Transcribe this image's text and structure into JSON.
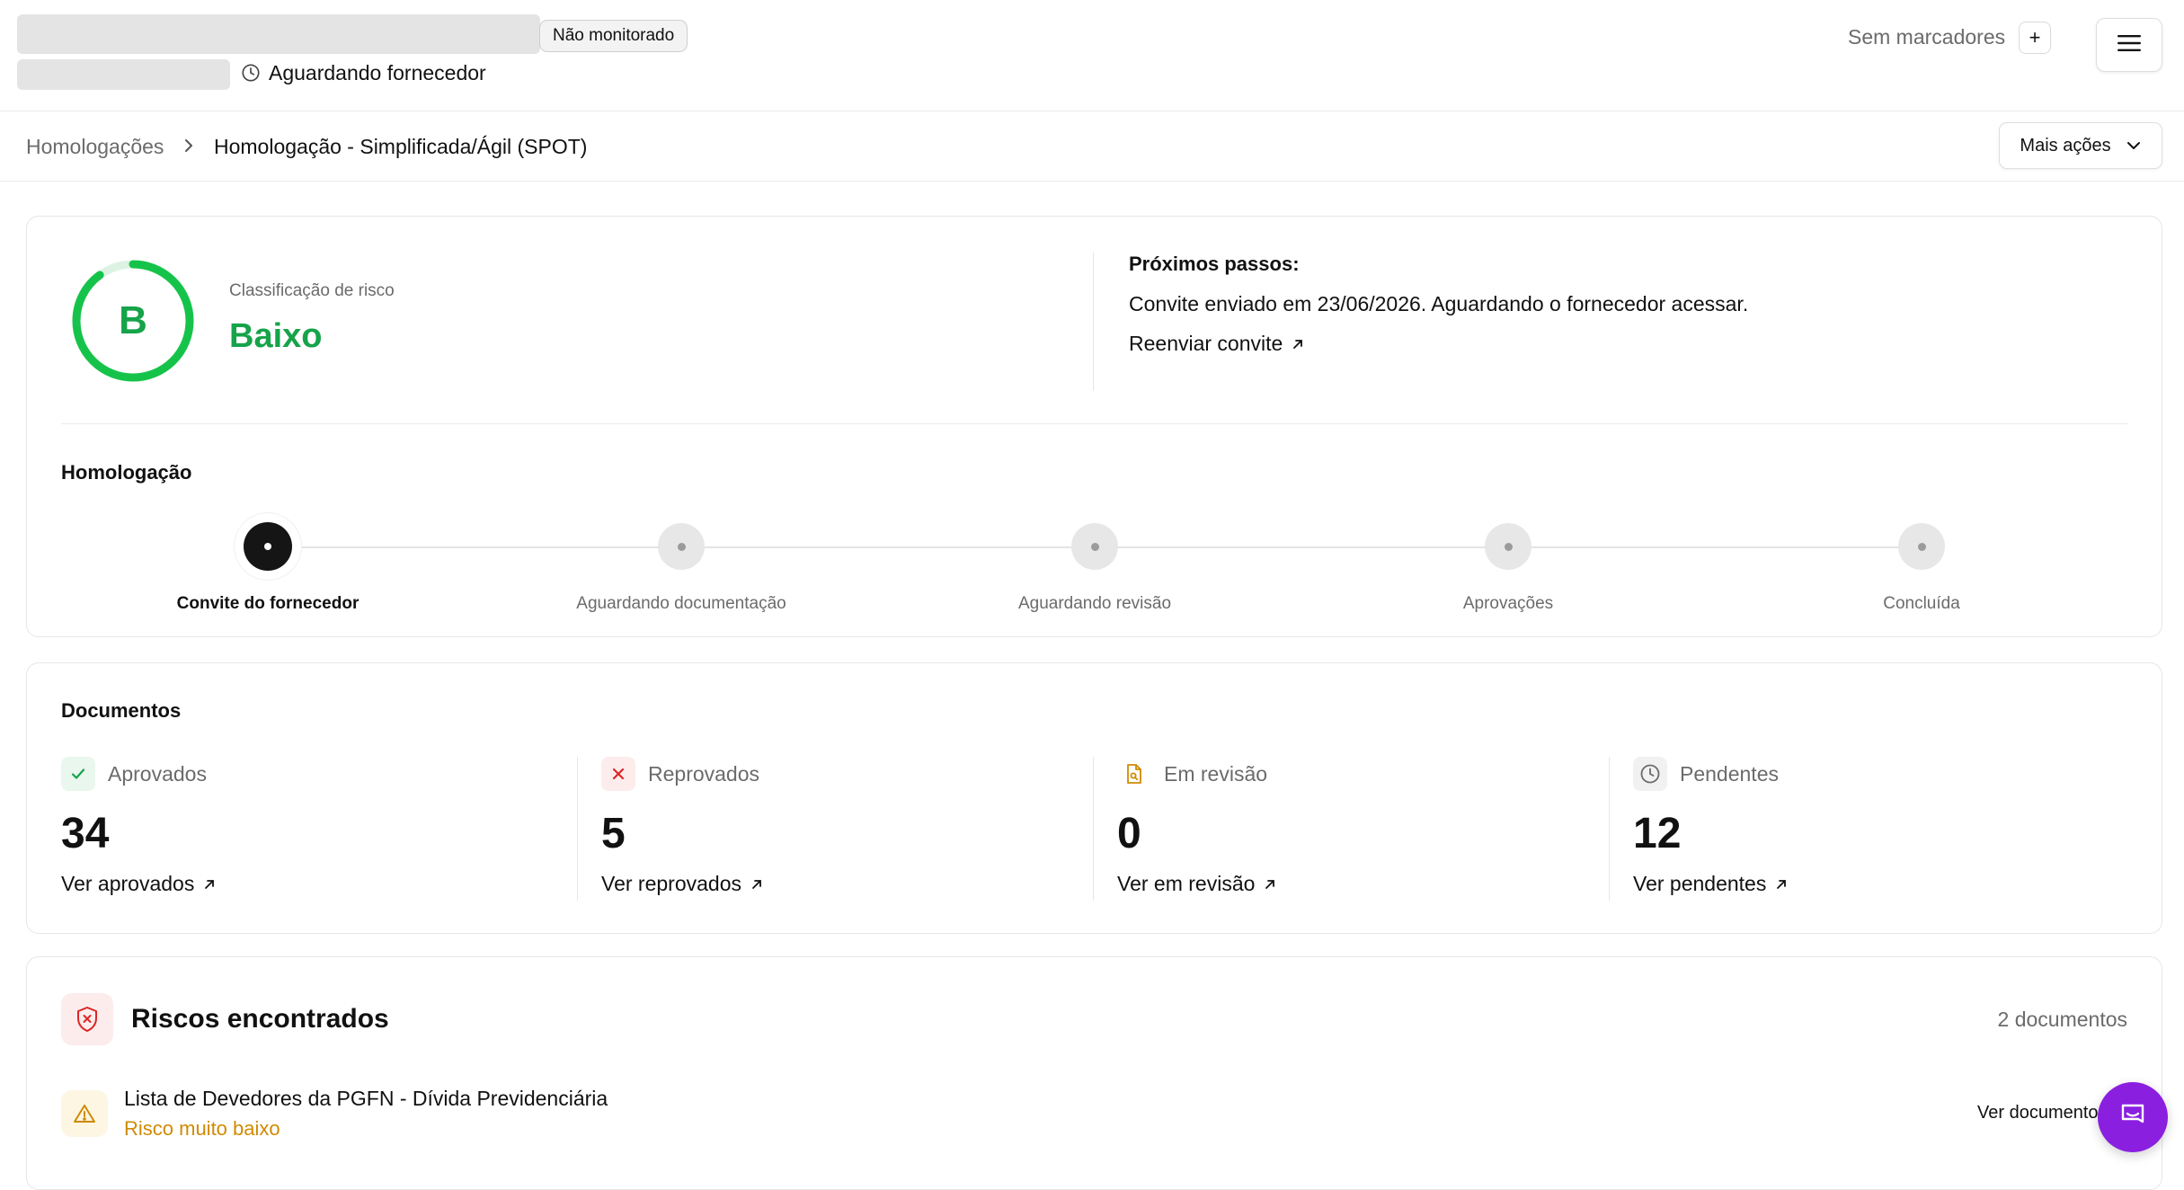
{
  "header": {
    "monitor_badge": "Não monitorado",
    "status": "Aguardando fornecedor",
    "tags_label": "Sem marcadores",
    "tags_add": "+"
  },
  "breadcrumb": {
    "root": "Homologações",
    "current": "Homologação - Simplificada/Ágil (SPOT)",
    "actions_label": "Mais ações"
  },
  "risk": {
    "grade": "B",
    "caption": "Classificação de risco",
    "level": "Baixo",
    "grade_progress": 0.9,
    "color": "#16a34a"
  },
  "next_steps": {
    "title": "Próximos passos:",
    "text": "Convite enviado em 23/06/2026. Aguardando o fornecedor acessar.",
    "link": "Reenviar convite"
  },
  "homologation": {
    "title": "Homologação",
    "current_step": 0,
    "steps": [
      {
        "label": "Convite do fornecedor"
      },
      {
        "label": "Aguardando documentação"
      },
      {
        "label": "Aguardando revisão"
      },
      {
        "label": "Aprovações"
      },
      {
        "label": "Concluída"
      }
    ]
  },
  "documents": {
    "title": "Documentos",
    "items": [
      {
        "label": "Aprovados",
        "count": "34",
        "link": "Ver aprovados",
        "icon": "check-icon",
        "color": "#16a34a"
      },
      {
        "label": "Reprovados",
        "count": "5",
        "link": "Ver reprovados",
        "icon": "x-icon",
        "color": "#dc2626"
      },
      {
        "label": "Em revisão",
        "count": "0",
        "link": "Ver em revisão",
        "icon": "document-search-icon",
        "color": "#d08a00"
      },
      {
        "label": "Pendentes",
        "count": "12",
        "link": "Ver pendentes",
        "icon": "clock-icon",
        "color": "#6b6b6b"
      }
    ]
  },
  "risks_found": {
    "title": "Riscos encontrados",
    "count": "2 documentos",
    "items": [
      {
        "title": "Lista de Devedores da PGFN - Dívida Previdenciária",
        "level": "Risco muito baixo",
        "link": "Ver documento"
      }
    ]
  }
}
